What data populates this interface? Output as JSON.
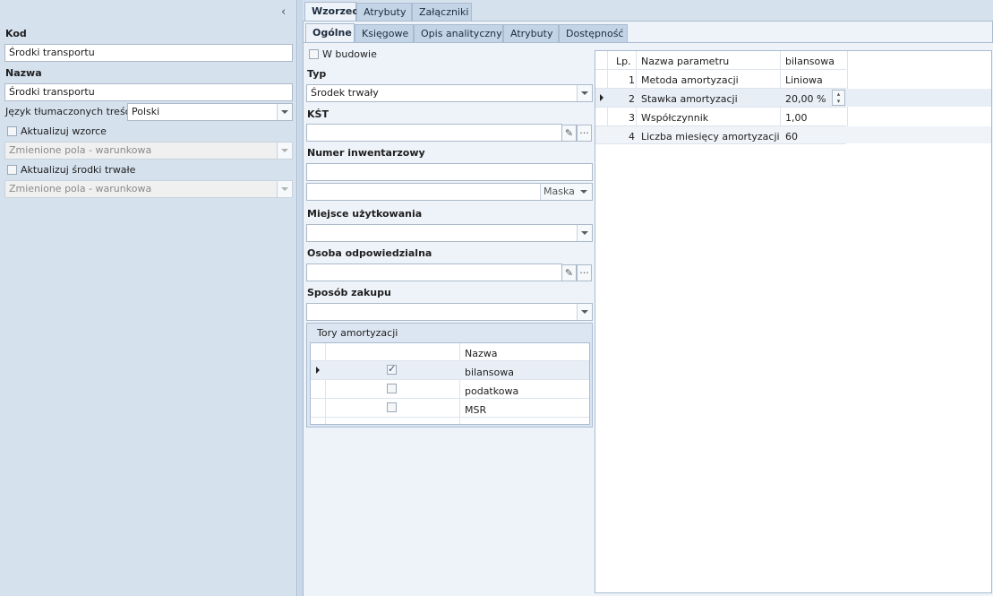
{
  "left_panel": {
    "collapse_icon": "chevron-left-icon",
    "kod_label": "Kod",
    "kod_value": "Środki transportu",
    "nazwa_label": "Nazwa",
    "nazwa_value": "Środki transportu",
    "jezyk_label": "Język tłumaczonych treści:",
    "jezyk_value": "Polski",
    "aktualizuj_wzorce_label": "Aktualizuj wzorce",
    "aktualizuj_wzorce_select": "Zmienione pola - warunkowa",
    "aktualizuj_srodki_label": "Aktualizuj środki trwałe",
    "aktualizuj_srodki_select": "Zmienione pola - warunkowa"
  },
  "top_tabs": [
    {
      "label": "Wzorzec",
      "active": true
    },
    {
      "label": "Atrybuty",
      "active": false
    },
    {
      "label": "Załączniki",
      "active": false
    }
  ],
  "sub_tabs": [
    {
      "label": "Ogólne",
      "active": true
    },
    {
      "label": "Księgowe",
      "active": false
    },
    {
      "label": "Opis analityczny",
      "active": false
    },
    {
      "label": "Atrybuty",
      "active": false
    },
    {
      "label": "Dostępność",
      "active": false
    }
  ],
  "form": {
    "w_budowie_label": "W budowie",
    "typ_label": "Typ",
    "typ_value": "Środek trwały",
    "kst_label": "KŚT",
    "kst_value": "",
    "numer_label": "Numer inwentarzowy",
    "numer_value": "",
    "maska_label": "Maska",
    "miejsce_label": "Miejsce użytkowania",
    "osoba_label": "Osoba odpowiedzialna",
    "sposob_label": "Sposób zakupu",
    "eraser_icon": "eraser-icon",
    "ellipsis_label": "···"
  },
  "tory": {
    "title": "Tory amortyzacji",
    "header_nazwa": "Nazwa",
    "rows": [
      {
        "name": "bilansowa",
        "checked": true
      },
      {
        "name": "podatkowa",
        "checked": false
      },
      {
        "name": "MSR",
        "checked": false
      }
    ]
  },
  "params": {
    "headers": {
      "lp": "Lp.",
      "nazwa": "Nazwa parametru",
      "value": "bilansowa"
    },
    "rows": [
      {
        "lp": "1",
        "nazwa": "Metoda amortyzacji",
        "value": "Liniowa"
      },
      {
        "lp": "2",
        "nazwa": "Stawka amortyzacji",
        "value": "20,00 %"
      },
      {
        "lp": "3",
        "nazwa": "Współczynnik",
        "value": "1,00"
      },
      {
        "lp": "4",
        "nazwa": "Liczba miesięcy amortyzacji",
        "value": "60"
      }
    ]
  }
}
